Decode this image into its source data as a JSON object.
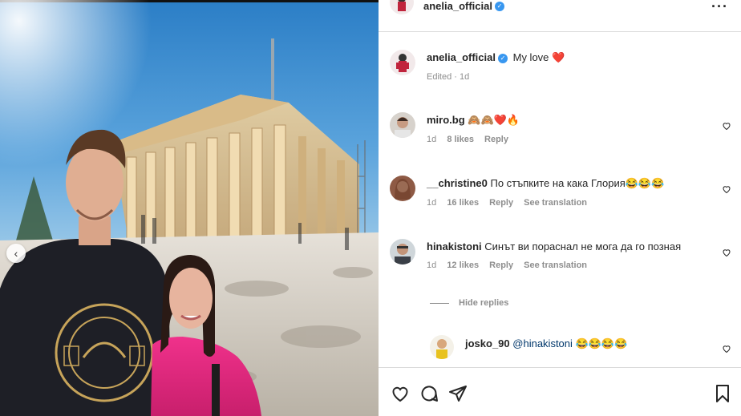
{
  "post": {
    "author": "anelia_official",
    "caption_text": "My love",
    "caption_emoji": "❤️",
    "caption_meta": "Edited · 1d"
  },
  "header": {
    "username": "anelia_official",
    "more_label": "···"
  },
  "comments": [
    {
      "username": "miro.bg",
      "text": "🙈🙈❤️🔥",
      "time": "1d",
      "likes": "8 likes",
      "reply": "Reply",
      "translate": ""
    },
    {
      "username": "__christine0",
      "text": "По стъпките на кака Глория😂😂😂",
      "time": "1d",
      "likes": "16 likes",
      "reply": "Reply",
      "translate": "See translation"
    },
    {
      "username": "hinakistoni",
      "text": "Синът ви пораснал не мога да го позная",
      "time": "1d",
      "likes": "12 likes",
      "reply": "Reply",
      "translate": "See translation"
    }
  ],
  "hide_replies_label": "Hide replies",
  "reply_comment": {
    "username": "josko_90",
    "mention": "@hinakistoni",
    "text": "😂😂😂😂"
  },
  "actions": {
    "like_icon": "heart-icon",
    "comment_icon": "comment-icon",
    "share_icon": "send-icon",
    "save_icon": "bookmark-icon"
  },
  "colors": {
    "verified": "#3897f0",
    "heart_red": "#e0245e",
    "meta_gray": "#8e8e8e",
    "mention_blue": "#00376b"
  }
}
